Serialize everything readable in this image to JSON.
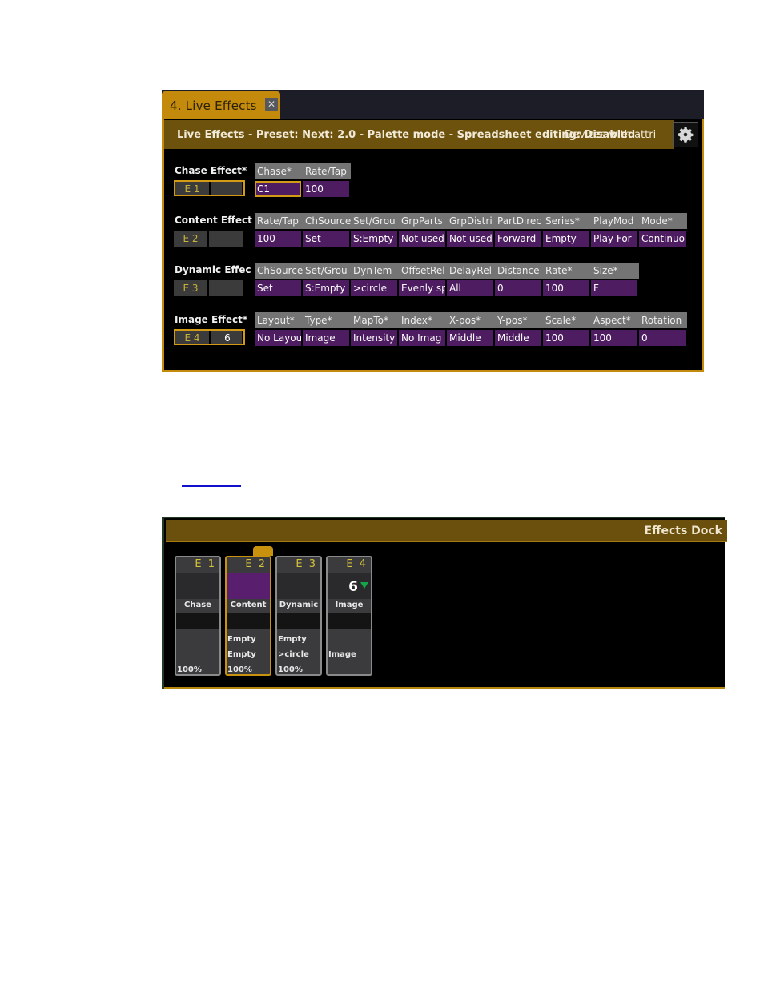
{
  "live_effects": {
    "tab_label": "4. Live Effects",
    "tab_close_icon": "close-icon",
    "title": "Live Effects - Preset:  Next: 2.0 - Palette mode - Spreadsheet editing: Disabled",
    "title_overlay": "Devices with attri",
    "settings_icon": "gear-icon",
    "rows": [
      {
        "label": "Chase Effect*",
        "id": "E 1",
        "id_value": "",
        "selected": true,
        "headers": [
          "Chase*",
          "Rate/Tap"
        ],
        "values": [
          "C1",
          "100"
        ]
      },
      {
        "label": "Content Effect",
        "id": "E 2",
        "id_value": "",
        "selected": false,
        "headers": [
          "Rate/Tap",
          "ChSource",
          "Set/Grou",
          "GrpParts",
          "GrpDistri",
          "PartDirec",
          "Series*",
          "PlayMod",
          "Mode*"
        ],
        "values": [
          "100",
          "Set",
          "S:Empty",
          "Not used",
          "Not used",
          "Forward",
          "Empty",
          "Play For",
          "Continuo"
        ]
      },
      {
        "label": "Dynamic Effec",
        "id": "E 3",
        "id_value": "",
        "selected": false,
        "headers": [
          "ChSource",
          "Set/Grou",
          "DynTem",
          "OffsetRel",
          "DelayRel",
          "Distance",
          "Rate*",
          "Size*"
        ],
        "values": [
          "Set",
          "S:Empty",
          ">circle",
          "Evenly sp",
          "All",
          "0",
          "100",
          "F"
        ]
      },
      {
        "label": "Image Effect*",
        "id": "E 4",
        "id_value": "6",
        "selected": true,
        "headers": [
          "Layout*",
          "Type*",
          "MapTo*",
          "Index*",
          "X-pos*",
          "Y-pos*",
          "Scale*",
          "Aspect*",
          "Rotation"
        ],
        "values": [
          "No Layou",
          "Image",
          "Intensity",
          "No Imag",
          "Middle",
          "Middle",
          "100",
          "100",
          "0"
        ]
      }
    ]
  },
  "link_text": "",
  "effects_dock": {
    "title": "Effects Dock",
    "effects": [
      {
        "id": "E 1",
        "number": "",
        "name": "Chase",
        "lines": [
          "",
          "",
          "100%"
        ],
        "selected": false
      },
      {
        "id": "E 2",
        "number": "",
        "name": "Content",
        "lines": [
          "Empty",
          "Empty",
          "100%"
        ],
        "selected": true
      },
      {
        "id": "E 3",
        "number": "",
        "name": "Dynamic",
        "lines": [
          "Empty",
          ">circle",
          "100%"
        ],
        "selected": false
      },
      {
        "id": "E 4",
        "number": "6",
        "name": "Image",
        "lines": [
          "",
          "Image",
          ""
        ],
        "selected": false
      }
    ]
  },
  "colors": {
    "accent_gold": "#c48a0c",
    "value_purple": "#4e1d61",
    "header_gray": "#747474",
    "title_brown": "#6d520d",
    "indicator_green": "#14a44a"
  }
}
